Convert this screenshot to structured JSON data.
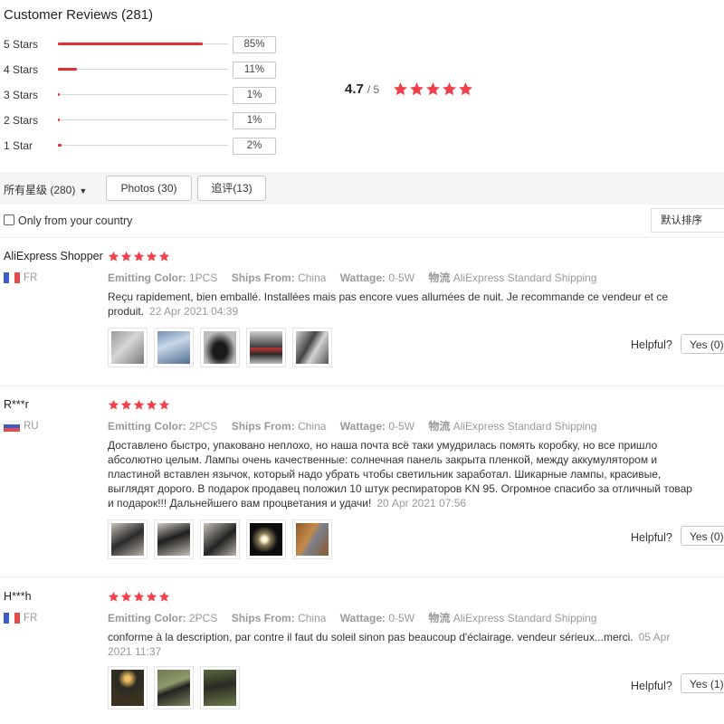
{
  "header": {
    "title": "Customer Reviews (281)"
  },
  "breakdown": [
    {
      "label": "5 Stars",
      "pct": "85%",
      "value": 85
    },
    {
      "label": "4 Stars",
      "pct": "11%",
      "value": 11
    },
    {
      "label": "3 Stars",
      "pct": "1%",
      "value": 1
    },
    {
      "label": "2 Stars",
      "pct": "1%",
      "value": 1
    },
    {
      "label": "1 Star",
      "pct": "2%",
      "value": 2
    }
  ],
  "average": {
    "score": "4.7",
    "out_of": "/ 5",
    "stars": 5
  },
  "colors": {
    "accent": "#e62e2e",
    "star": "#f2404a"
  },
  "filters": {
    "all_ratings": "所有星级 (280)",
    "photos": "Photos (30)",
    "additional": "追评(13)",
    "only_country": "Only from your country",
    "sort": "默认排序"
  },
  "attr_labels": {
    "color": "Emitting Color:",
    "ships": "Ships From:",
    "wattage": "Wattage:",
    "logistics": "物流"
  },
  "helpful_label": "Helpful?",
  "reviews": [
    {
      "name": "AliExpress Shopper",
      "country": "FR",
      "stars": 5,
      "color": "1PCS",
      "ships": "China",
      "wattage": "0-5W",
      "logistics": "AliExpress Standard Shipping",
      "text": "Reçu rapidement, bien emballé. Installées mais pas encore vues allumées de nuit. Je recommande ce vendeur et ce produit.",
      "date": "22 Apr 2021 04:39",
      "helpful": "Yes (0)"
    },
    {
      "name": "R***r",
      "country": "RU",
      "stars": 5,
      "color": "2PCS",
      "ships": "China",
      "wattage": "0-5W",
      "logistics": "AliExpress Standard Shipping",
      "text": "Доставлено быстро, упаковано неплохо, но наша почта всё таки умудрилась помять коробку, но все пришло абсолютно целым. Лампы очень качественные: солнечная панель закрыта пленкой, между аккумулятором и пластиной вставлен язычок, который надо убрать чтобы светильник заработал. Шикарные лампы, красивые, выглядят дорого. В подарок продавец положил 10 штук респираторов KN 95. Огромное спасибо за отличный товар и подарок!!! Дальнейшего вам процветания и удачи!",
      "date": "20 Apr 2021 07:56",
      "helpful": "Yes (0)"
    },
    {
      "name": "H***h",
      "country": "FR",
      "stars": 5,
      "color": "2PCS",
      "ships": "China",
      "wattage": "0-5W",
      "logistics": "AliExpress Standard Shipping",
      "text": "conforme à la description, par contre il faut du soleil sinon pas beaucoup d'éclairage. vendeur sérieux...merci.",
      "date": "05 Apr 2021 11:37",
      "helpful": "Yes (1)"
    }
  ]
}
